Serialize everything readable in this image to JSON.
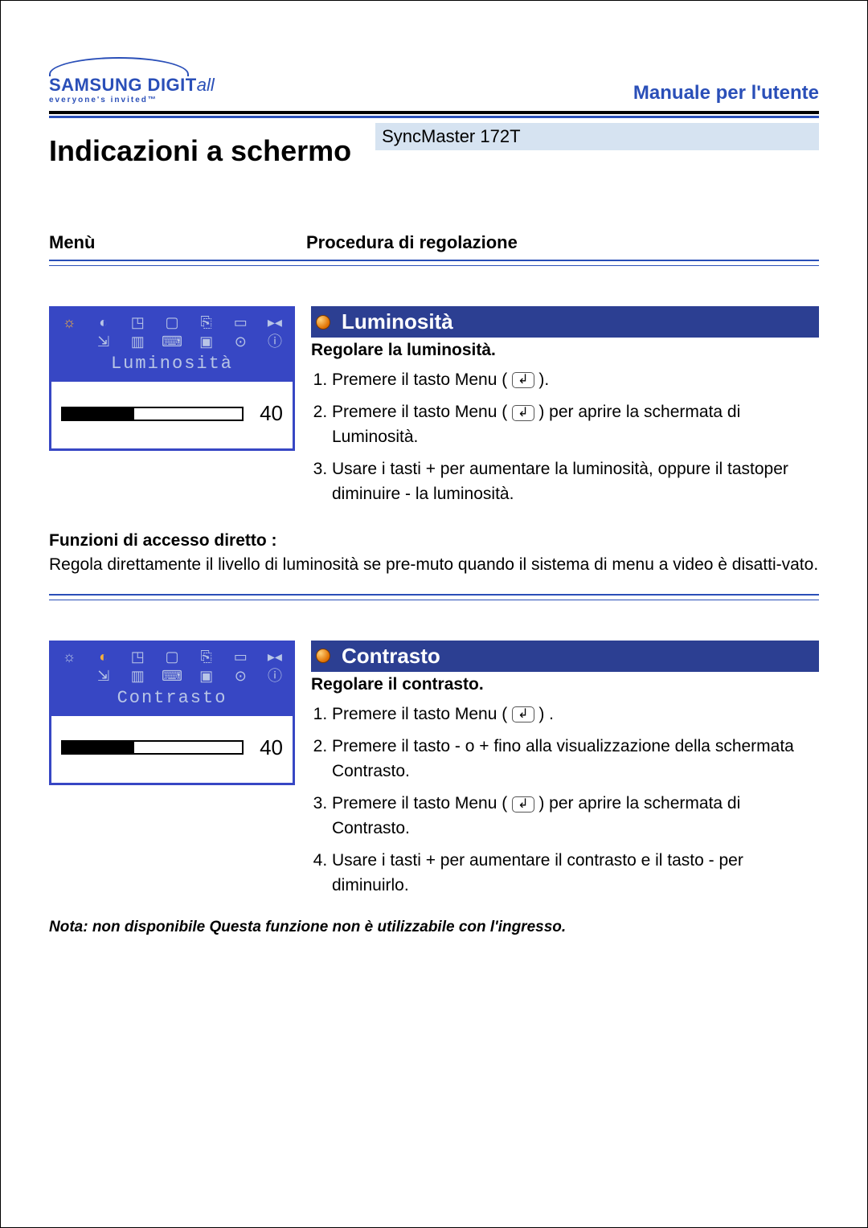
{
  "header": {
    "logo_brand": "SAMSUNG DIGIT",
    "logo_suffix": "all",
    "logo_tag": "everyone's invited™",
    "manual_title": "Manuale per l'utente"
  },
  "page_title": "Indicazioni a schermo",
  "model": "SyncMaster 172T",
  "columns": {
    "left": "Menù",
    "right": "Procedura di regolazione"
  },
  "sections": [
    {
      "osd_label": "Luminosità",
      "slider_value": "40",
      "slider_percent": 40,
      "highlight_index": 0,
      "title": "Luminosità",
      "subtitle": "Regolare la luminosità.",
      "steps": [
        "Premere il tasto Menu ( [↲] ).",
        "Premere il tasto Menu ( [↲] ) per aprire la schermata di Luminosità.",
        "Usare i tasti + per aumentare la luminosità, oppure il tastoper diminuire - la luminosità."
      ],
      "below_label": "Funzioni di accesso diretto :",
      "below_text": "Regola direttamente il livello di luminosità se pre-muto quando il sistema di menu a video è disatti-vato.",
      "note": ""
    },
    {
      "osd_label": "Contrasto",
      "slider_value": "40",
      "slider_percent": 40,
      "highlight_index": 1,
      "title": "Contrasto",
      "subtitle": "Regolare il contrasto.",
      "steps": [
        "Premere il tasto Menu ( [↲] ) .",
        "Premere il tasto - o + fino alla visualizzazione della schermata Contrasto.",
        "Premere il tasto Menu ( [↲] ) per aprire la schermata di Contrasto.",
        "Usare i tasti + per aumentare il contrasto e il tasto - per diminuirlo."
      ],
      "below_label": "",
      "below_text": "",
      "note": "Nota: non disponibile Questa funzione non è utilizzabile con l'ingresso."
    }
  ]
}
